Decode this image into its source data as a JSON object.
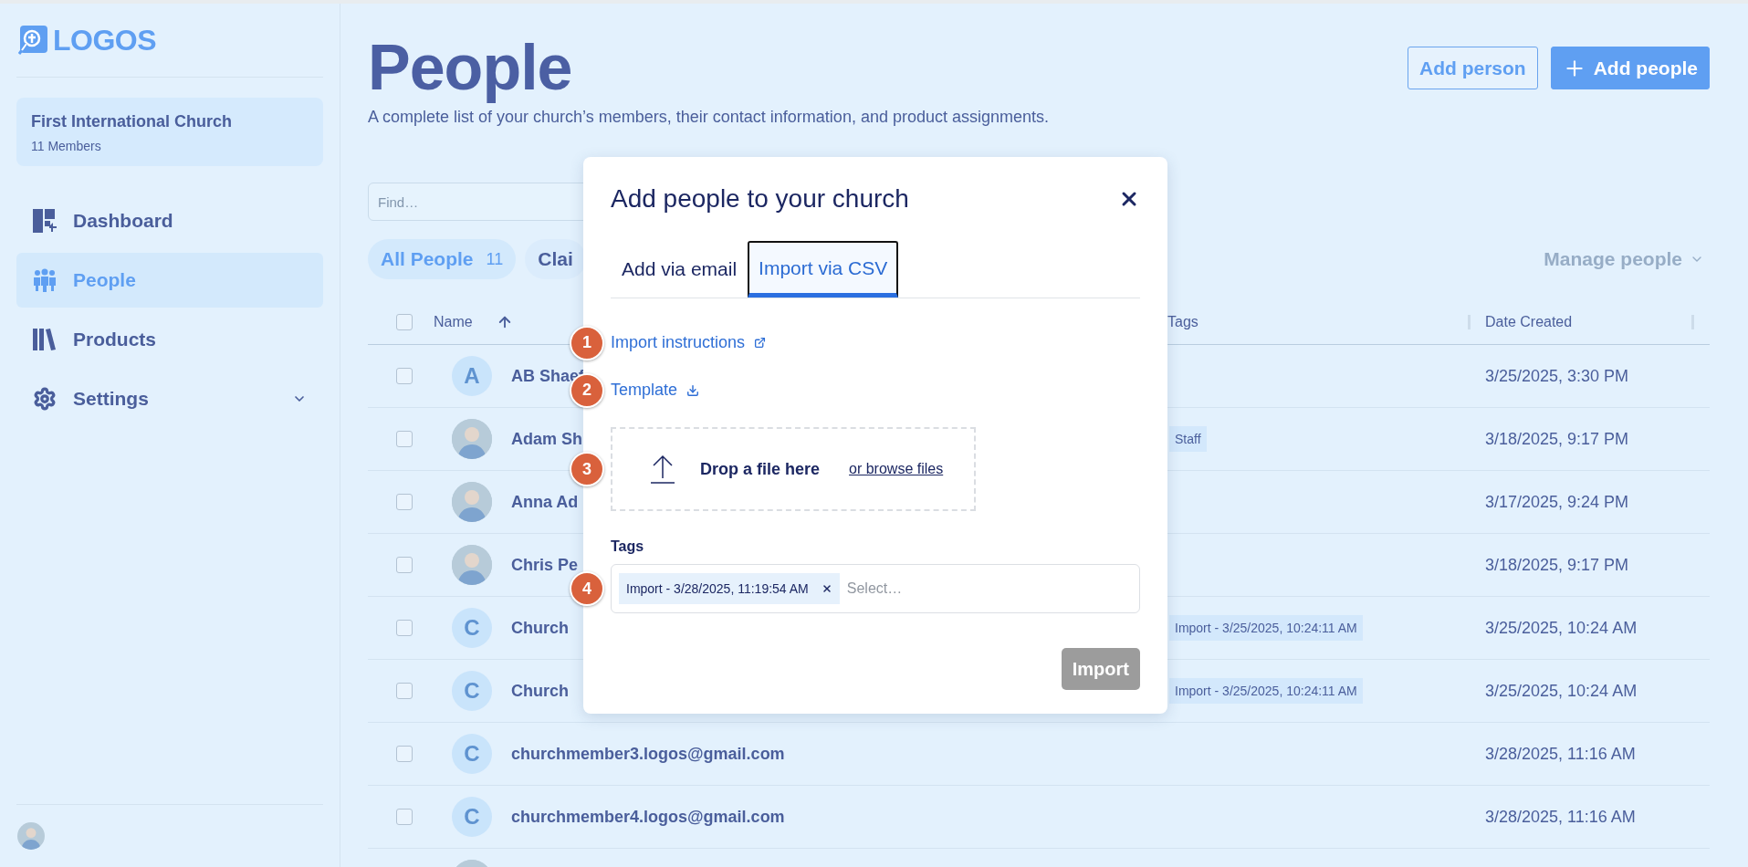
{
  "sidebar": {
    "logo": "LOGOS",
    "church": {
      "name": "First International Church",
      "members": "11 Members"
    },
    "nav": [
      {
        "label": "Dashboard",
        "selected": false
      },
      {
        "label": "People",
        "selected": true
      },
      {
        "label": "Products",
        "selected": false
      },
      {
        "label": "Settings",
        "selected": false,
        "expandable": true
      }
    ],
    "user": {
      "avatar": {
        "kind": "photo"
      }
    }
  },
  "header": {
    "title": "People",
    "subtitle": "A complete list of your church’s members, their contact information, and product assignments.",
    "buttons": [
      {
        "label": "Add person",
        "kind": "outline"
      },
      {
        "label": "Add people",
        "kind": "primary"
      }
    ]
  },
  "search": {
    "placeholder": "Find…"
  },
  "filters": [
    {
      "label": "All People",
      "count": "11",
      "selected": true
    },
    {
      "label": "Clai",
      "selected": false
    }
  ],
  "manage_menu": {
    "label": "Manage people",
    "disabled": true
  },
  "table": {
    "select_all": {
      "checked": false
    },
    "columns": [
      {
        "label": "Name",
        "sorted": true
      },
      {
        "label": "Tags"
      },
      {
        "label": "Date Created"
      }
    ],
    "rows": [
      {
        "checked": false,
        "avatar": {
          "kind": "letter",
          "letter": "A"
        },
        "name": "AB Shaef",
        "date": "3/25/2025, 3:30 PM"
      },
      {
        "checked": false,
        "avatar": {
          "kind": "photo"
        },
        "name": "Adam Sh",
        "tags": [
          "Staff"
        ],
        "date": "3/18/2025, 9:17 PM"
      },
      {
        "checked": false,
        "avatar": {
          "kind": "photo"
        },
        "name": "Anna Ad",
        "date": "3/17/2025, 9:24 PM"
      },
      {
        "checked": false,
        "avatar": {
          "kind": "photo"
        },
        "name": "Chris Pe",
        "date": "3/18/2025, 9:17 PM"
      },
      {
        "checked": false,
        "avatar": {
          "kind": "letter",
          "letter": "C"
        },
        "name": "Church",
        "tags": [
          "Import - 3/25/2025, 10:24:11 AM"
        ],
        "date": "3/25/2025, 10:24 AM"
      },
      {
        "checked": false,
        "avatar": {
          "kind": "letter",
          "letter": "C"
        },
        "name": "Church",
        "tags": [
          "Import - 3/25/2025, 10:24:11 AM"
        ],
        "date": "3/25/2025, 10:24 AM"
      },
      {
        "checked": false,
        "avatar": {
          "kind": "letter",
          "letter": "C"
        },
        "name": "churchmember3.logos@gmail.com",
        "date": "3/28/2025, 11:16 AM"
      },
      {
        "checked": false,
        "avatar": {
          "kind": "letter",
          "letter": "C"
        },
        "name": "churchmember4.logos@gmail.com",
        "date": "3/28/2025, 11:16 AM"
      },
      {
        "avatar": {
          "kind": "photo"
        }
      }
    ]
  },
  "modal": {
    "title": "Add people to your church",
    "tabs": [
      {
        "label": "Add via email",
        "selected": false
      },
      {
        "label": "Import via CSV",
        "selected": true
      }
    ],
    "instructions": {
      "badge": "1",
      "label": "Import instructions"
    },
    "template": {
      "badge": "2",
      "label": "Template"
    },
    "dropzone": {
      "badge": "3",
      "text": "Drop a file here",
      "link": "or browse files"
    },
    "tags": {
      "badge": "4",
      "label": "Tags",
      "chips": [
        "Import - 3/28/2025, 11:19:54 AM"
      ],
      "placeholder": "Select…"
    },
    "submit": {
      "label": "Import",
      "disabled": true
    }
  }
}
